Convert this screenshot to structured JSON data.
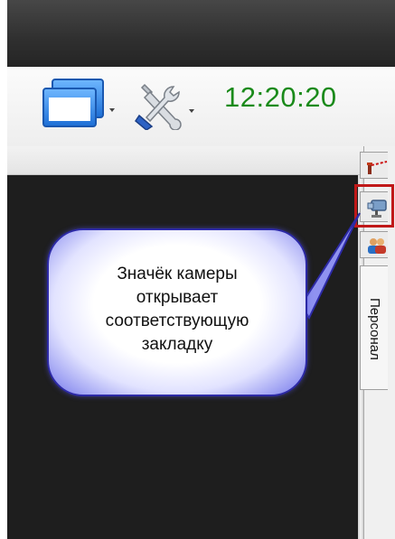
{
  "toolbar": {
    "window_icon": "windows-icon",
    "tools_icon": "wrench-screwdriver-icon",
    "clock": "12:20:20",
    "clock_color": "#1a8a1a"
  },
  "side_tabs": [
    {
      "icon": "gate-icon"
    },
    {
      "icon": "camera-icon"
    },
    {
      "icon": "people-icon"
    },
    {
      "label": "Персонал"
    }
  ],
  "callout": {
    "text": "Значёк камеры\nоткрывает\nсоответствующую\nзакладку",
    "highlight_color": "#c01818"
  }
}
